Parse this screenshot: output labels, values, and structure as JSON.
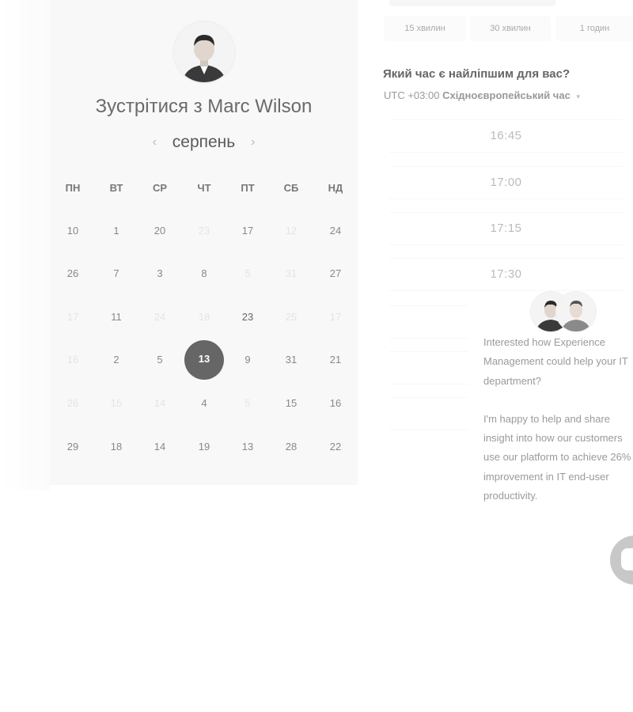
{
  "booking": {
    "title": "Зустрітися з Marc Wilson",
    "month": "серпень",
    "prev_icon": "‹",
    "next_icon": "›",
    "weekdays": [
      "ПН",
      "ВТ",
      "СР",
      "ЧТ",
      "ПТ",
      "СБ",
      "НД"
    ],
    "weeks": [
      [
        "10",
        "1",
        "20",
        "23",
        "17",
        "12",
        "24"
      ],
      [
        "26",
        "7",
        "3",
        "8",
        "5",
        "31",
        "27"
      ],
      [
        "17",
        "11",
        "24",
        "18",
        "23",
        "25",
        "17"
      ],
      [
        "16",
        "2",
        "5",
        "13",
        "9",
        "31",
        "21"
      ],
      [
        "26",
        "15",
        "14",
        "4",
        "5",
        "15",
        "16"
      ],
      [
        "29",
        "18",
        "14",
        "19",
        "13",
        "28",
        "22"
      ]
    ],
    "selected_day": "13"
  },
  "durations": [
    "15 хвилин",
    "30 хвилин",
    "1 годин"
  ],
  "time_picker": {
    "question": "Який час є найліпшим для вас?",
    "tz_offset": "UTC +03:00",
    "tz_name": "Східноєвропейський час",
    "tz_caret": "▾",
    "slots": [
      "16:45",
      "17:00",
      "17:15",
      "17:30"
    ]
  },
  "chat": {
    "message_1": "Interested how Experience Management could help your IT department?",
    "message_2": "I'm happy to help and share insight into how our customers use our platform to achieve 26% improvement in IT end-user productivity."
  },
  "colors": {
    "selected_bg": "#666666",
    "card_bg": "#f8f8f8"
  }
}
